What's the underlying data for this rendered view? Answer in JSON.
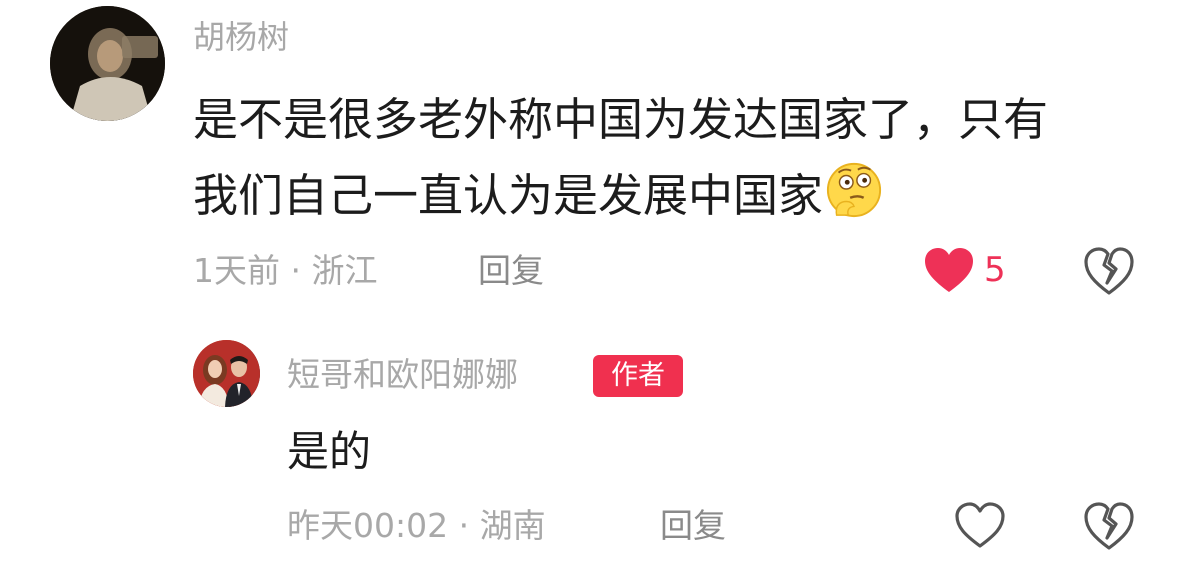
{
  "comment": {
    "username": "胡杨树",
    "text_line1": "是不是很多老外称中国为发达国家了，只有",
    "text_line2": "我们自己一直认为是发展中国家",
    "emoji": "thinking-face-icon",
    "meta": "1天前 · 浙江",
    "reply_label": "回复",
    "like_count": "5",
    "liked": true
  },
  "reply": {
    "username": "短哥和欧阳娜娜",
    "badge": "作者",
    "text": "是的",
    "meta": "昨天00:02 · 湖南",
    "reply_label": "回复",
    "liked": false
  },
  "colors": {
    "accent": "#ee3157",
    "muted_text": "#a8a8a8",
    "body_text": "#1c1c1c",
    "badge_bg": "#f0304f"
  }
}
